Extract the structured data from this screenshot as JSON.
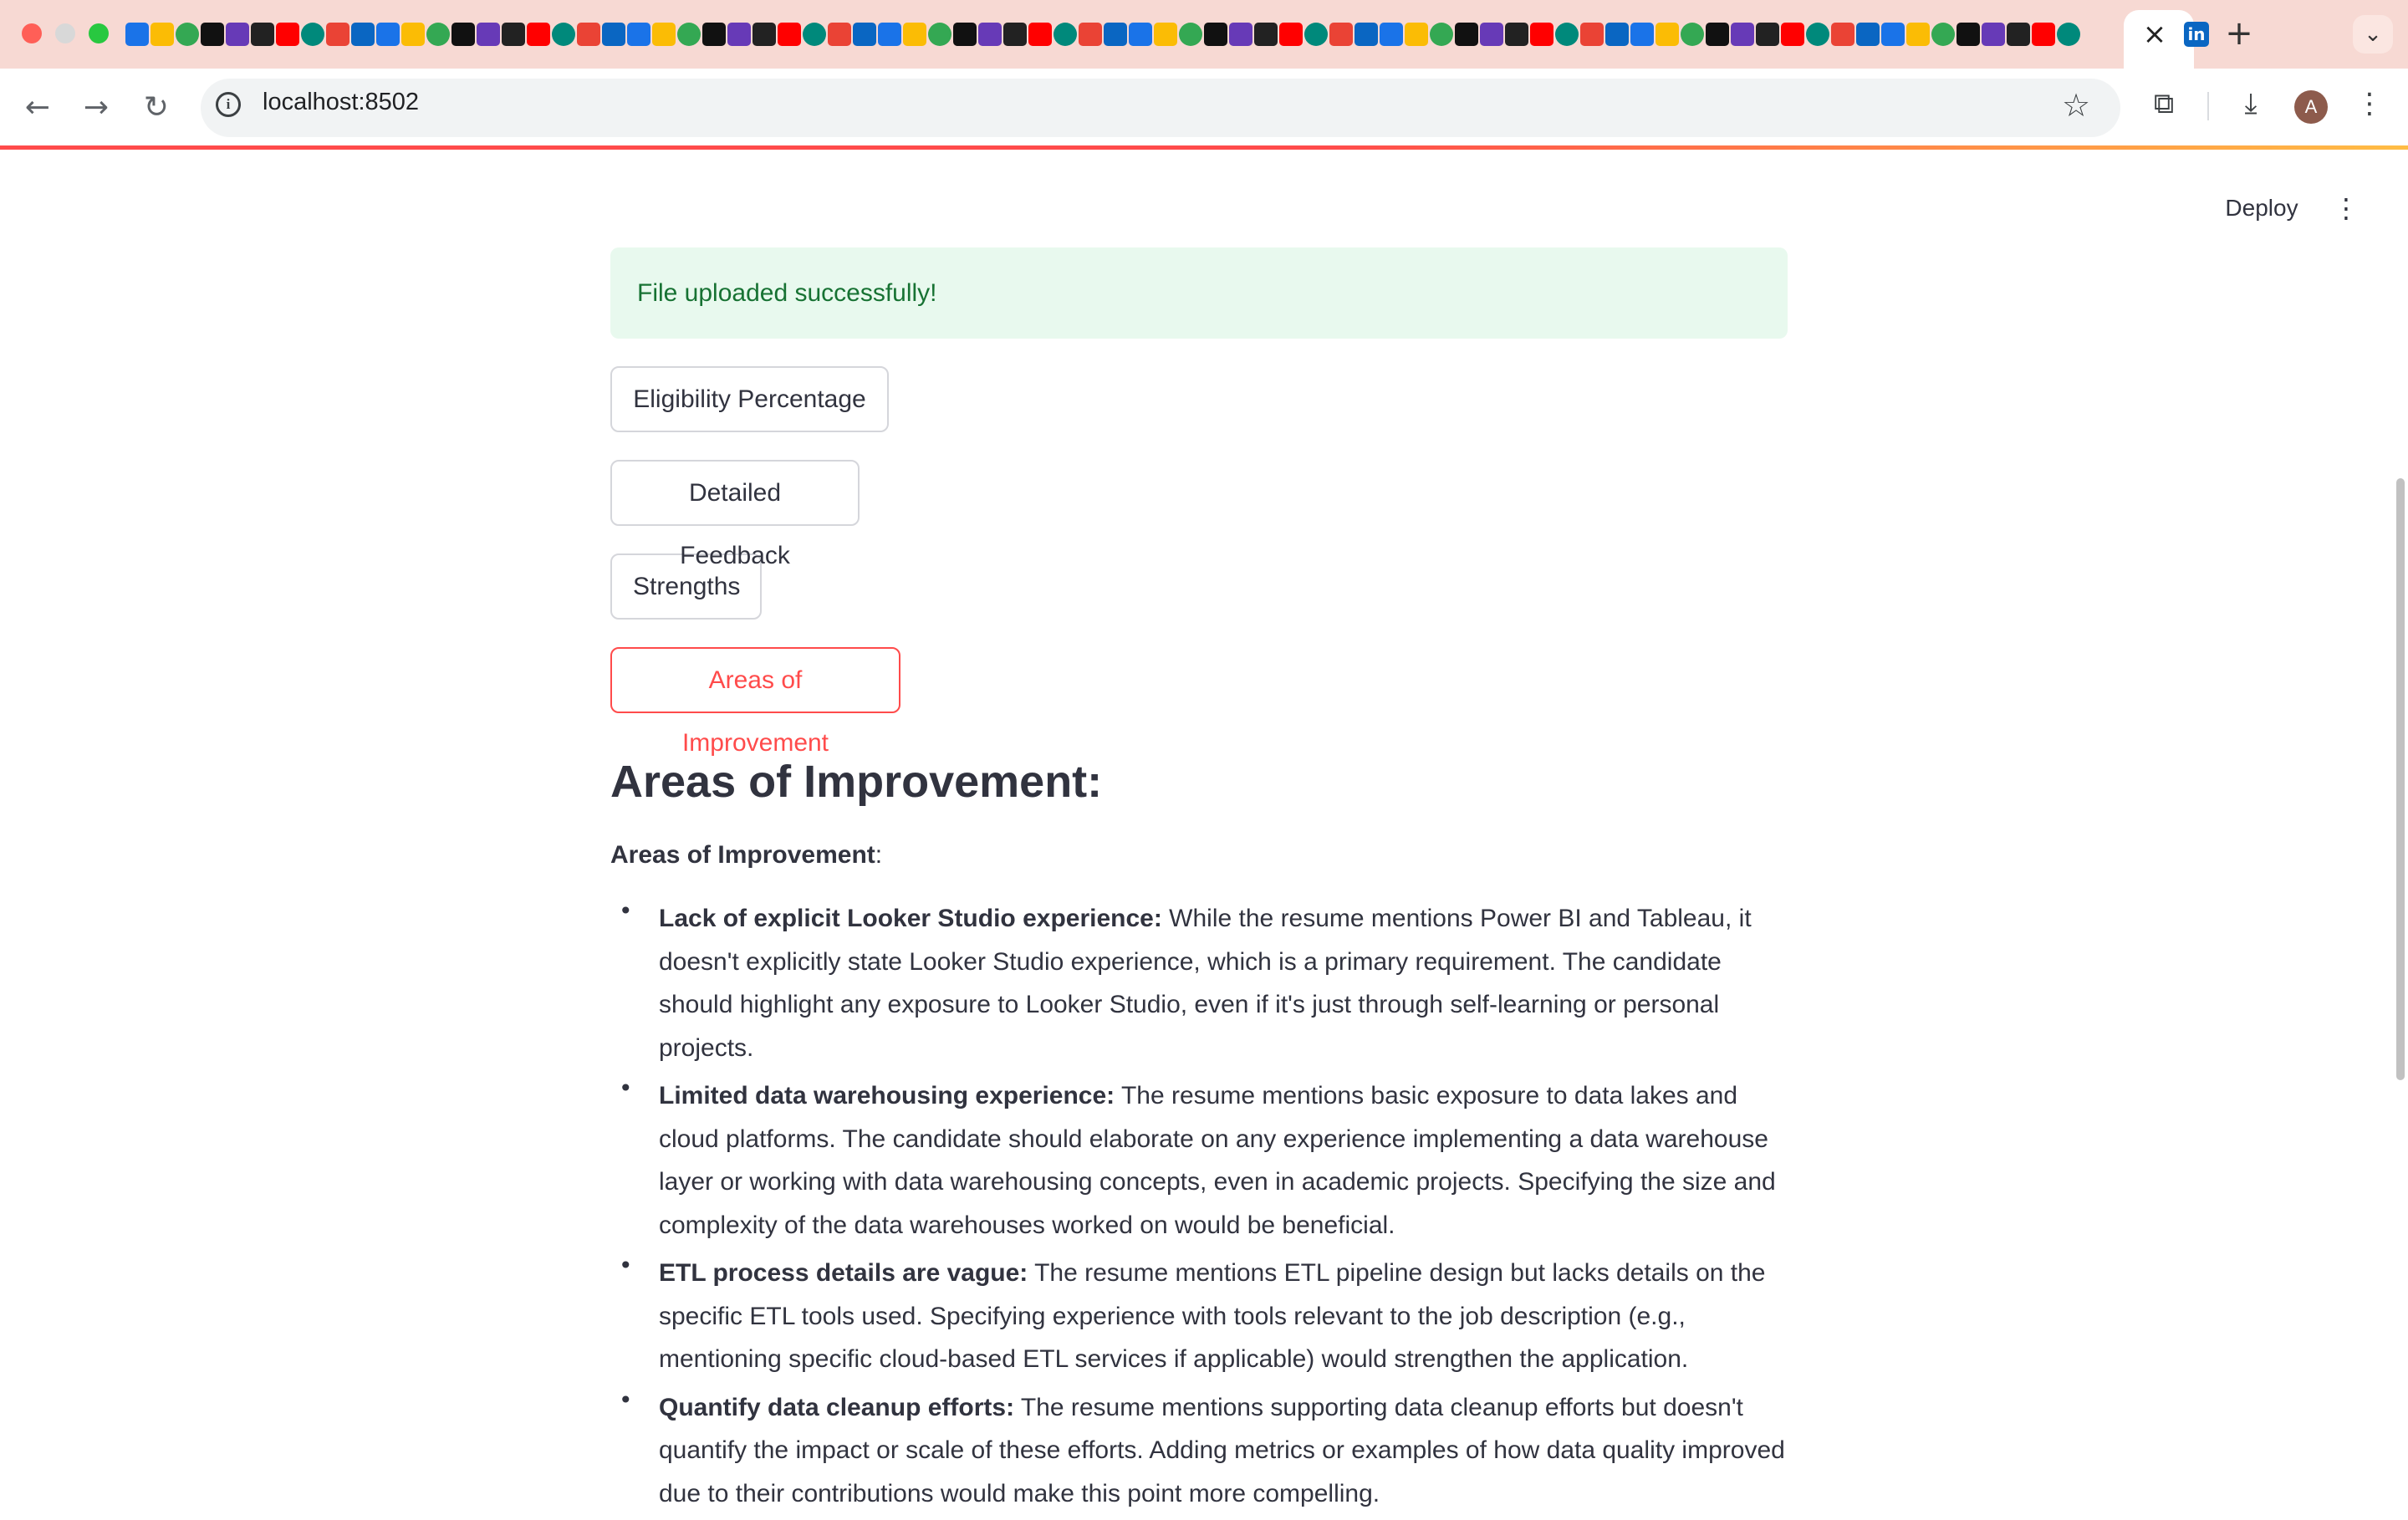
{
  "browser": {
    "url": "localhost:8502",
    "favicon_colors": [
      "#1a73e8",
      "#111111",
      "#ff0000",
      "#0a66c2",
      "#34a853",
      "#222222",
      "#ea4335",
      "#fbbc05",
      "#673ab7",
      "#00897b"
    ],
    "favicon_count": 78,
    "active_tab_close_icon": "close-icon",
    "profile_initial": "A"
  },
  "header": {
    "deploy_label": "Deploy"
  },
  "main": {
    "alert_text": "File uploaded successfully!",
    "buttons": [
      {
        "label": "Eligibility Percentage"
      },
      {
        "label": "Detailed Feedback"
      },
      {
        "label": "Strengths"
      },
      {
        "label": "Areas of Improvement"
      }
    ],
    "heading": "Areas of Improvement:",
    "subheading": "Areas of Improvement",
    "subheading_suffix": ":",
    "items": [
      {
        "title": "Lack of explicit Looker Studio experience:",
        "text": " While the resume mentions Power BI and Tableau, it doesn't explicitly state Looker Studio experience, which is a primary requirement. The candidate should highlight any exposure to Looker Studio, even if it's just through self-learning or personal projects."
      },
      {
        "title": "Limited data warehousing experience:",
        "text": " The resume mentions basic exposure to data lakes and cloud platforms. The candidate should elaborate on any experience implementing a data warehouse layer or working with data warehousing concepts, even in academic projects. Specifying the size and complexity of the data warehouses worked on would be beneficial."
      },
      {
        "title": "ETL process details are vague:",
        "text": " The resume mentions ETL pipeline design but lacks details on the specific ETL tools used. Specifying experience with tools relevant to the job description (e.g., mentioning specific cloud-based ETL services if applicable) would strengthen the application."
      },
      {
        "title": "Quantify data cleanup efforts:",
        "text": " The resume mentions supporting data cleanup efforts but doesn't quantify the impact or scale of these efforts. Adding metrics or examples of how data quality improved due to their contributions would make this point more compelling."
      }
    ]
  },
  "colors": {
    "accent": "#ff4b4b",
    "success_bg": "#e8f9ee",
    "success_text": "#177233",
    "text": "#31333f"
  }
}
